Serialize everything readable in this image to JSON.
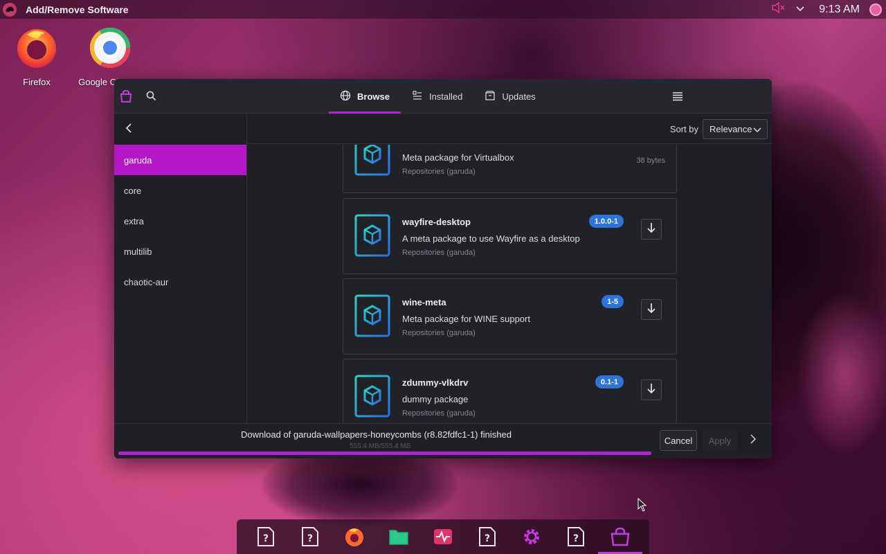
{
  "top_panel": {
    "app_title": "Add/Remove Software",
    "clock": "9:13 AM"
  },
  "desktop_icons": [
    {
      "label": "Firefox"
    },
    {
      "label": "Google Chrome"
    }
  ],
  "tabs": [
    {
      "label": "Browse",
      "active": true
    },
    {
      "label": "Installed",
      "active": false
    },
    {
      "label": "Updates",
      "active": false
    }
  ],
  "sidebar": {
    "items": [
      {
        "label": "garuda",
        "active": true
      },
      {
        "label": "core",
        "active": false
      },
      {
        "label": "extra",
        "active": false
      },
      {
        "label": "multilib",
        "active": false
      },
      {
        "label": "chaotic-aur",
        "active": false
      }
    ]
  },
  "sort": {
    "label": "Sort by",
    "selected": "Relevance"
  },
  "packages": [
    {
      "name": "",
      "description": "Meta package for Virtualbox",
      "repo": "Repositories (garuda)",
      "version": "",
      "size": "38 bytes"
    },
    {
      "name": "wayfire-desktop",
      "description": "A meta package to use Wayfire as a desktop",
      "repo": "Repositories (garuda)",
      "version": "1.0.0-1",
      "size": ""
    },
    {
      "name": "wine-meta",
      "description": "Meta package for WINE support",
      "repo": "Repositories (garuda)",
      "version": "1-5",
      "size": ""
    },
    {
      "name": "zdummy-vlkdrv",
      "description": "dummy package",
      "repo": "Repositories (garuda)",
      "version": "0.1-1",
      "size": ""
    }
  ],
  "bottom": {
    "status": "Download of garuda-wallpapers-honeycombs (r8.82fdfc1-1) finished",
    "size_progress": "555.4 MB/555.4 MB",
    "progress_fraction": 1.0,
    "cancel_label": "Cancel",
    "apply_label": "Apply"
  },
  "colors": {
    "accent": "#b322d8",
    "version_badge": "#2e74d8"
  }
}
